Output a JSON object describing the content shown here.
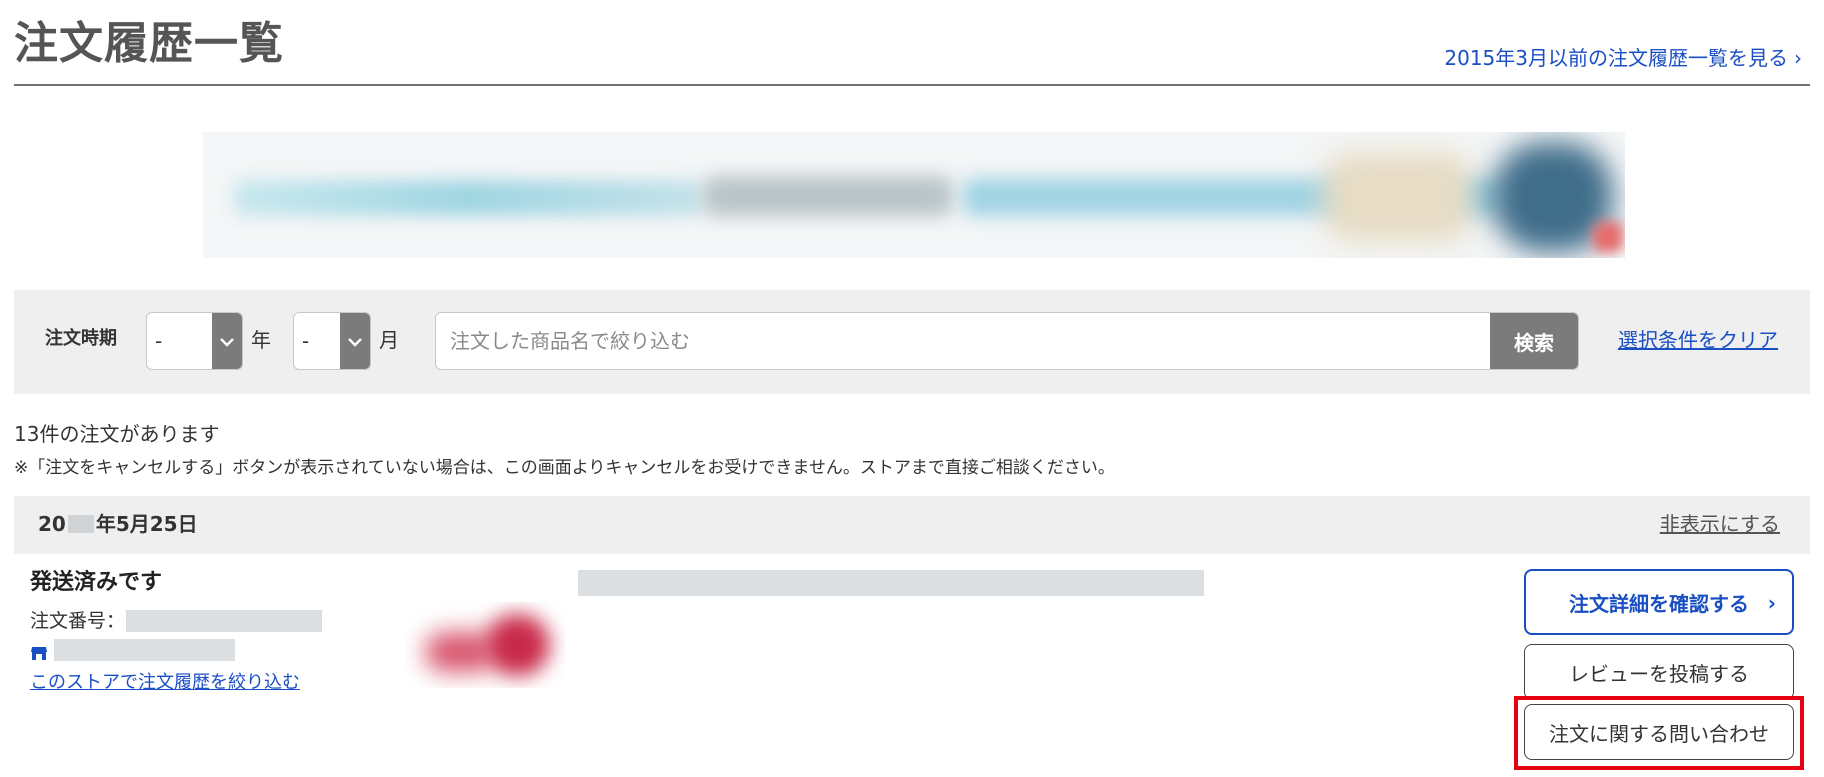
{
  "header": {
    "title": "注文履歴一覧",
    "old_history_link": "2015年3月以前の注文履歴一覧を見る",
    "chevron": "›"
  },
  "banner": {
    "icon": "blurred-promo-banner"
  },
  "filter": {
    "period_label": "注文時期",
    "year_value": "-",
    "year_unit": "年",
    "month_value": "-",
    "month_unit": "月",
    "search_placeholder": "注文した商品名で絞り込む",
    "search_value": "",
    "search_button": "検索",
    "clear_link": "選択条件をクリア"
  },
  "summary": {
    "count_text": "13件の注文があります",
    "cancel_note": "※「注文をキャンセルする」ボタンが表示されていない場合は、この画面よりキャンセルをお受けできません。ストアまで直接ご相談ください。"
  },
  "order": {
    "date_prefix": "20",
    "date_suffix": "年5月25日",
    "hide_link": "非表示にする",
    "status": "発送済みです",
    "order_number_label": "注文番号：",
    "store_filter_link": "このストアで注文履歴を絞り込む",
    "buttons": {
      "detail": "注文詳細を確認する",
      "detail_chevron": "›",
      "review": "レビューを投稿する",
      "inquiry": "注文に関する問い合わせ"
    }
  },
  "colors": {
    "link": "#1a4fc4",
    "highlight": "#e60012",
    "panel_bg": "#efefef",
    "button_gray": "#7b7b7b"
  }
}
